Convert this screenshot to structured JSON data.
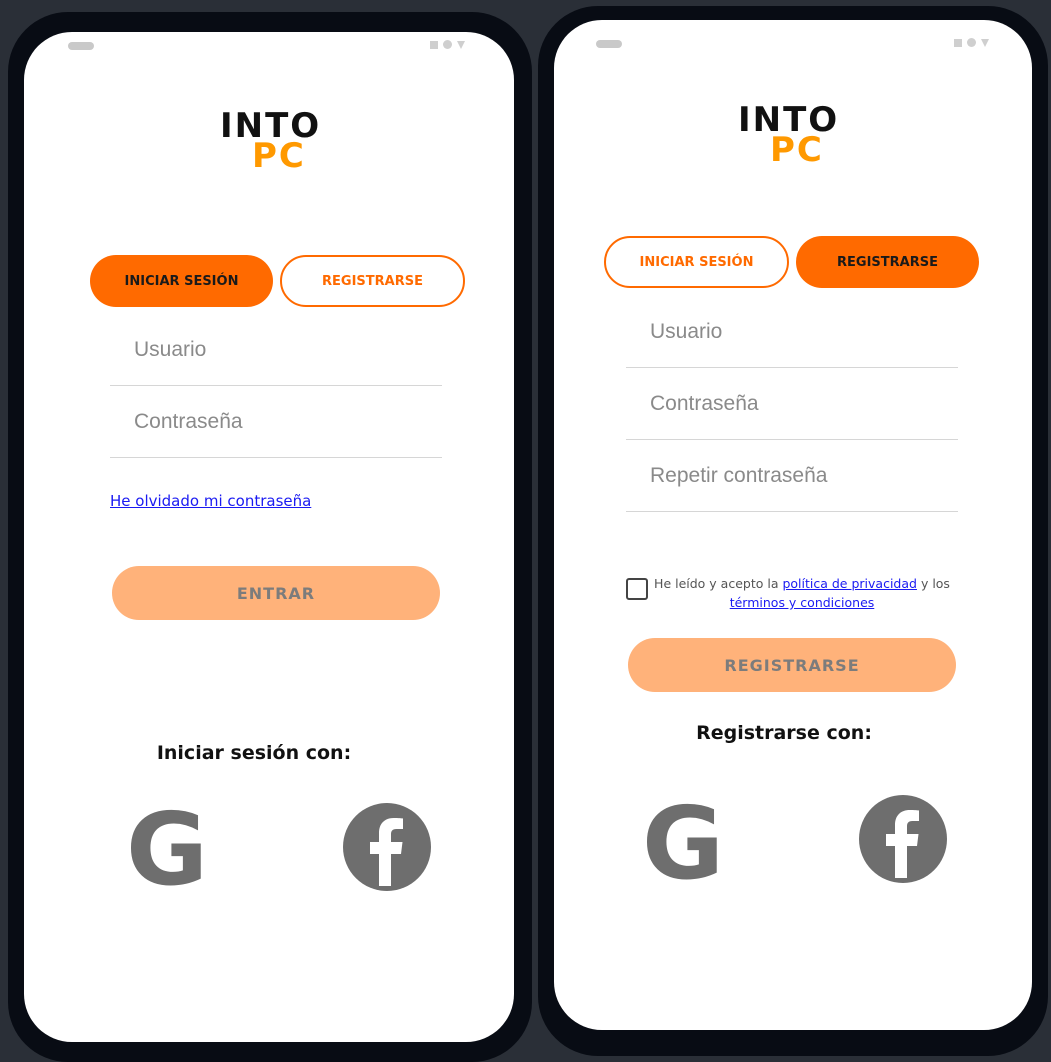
{
  "logo": {
    "into": "INTO",
    "pc": "PC"
  },
  "login_screen": {
    "tabs": {
      "login": "INICIAR SESIÓN",
      "register": "REGISTRARSE"
    },
    "username_placeholder": "Usuario",
    "password_placeholder": "Contraseña",
    "forgot_link": "He olvidado mi contraseña",
    "submit_label": "ENTRAR",
    "social_label": "Iniciar sesión con:"
  },
  "register_screen": {
    "tabs": {
      "login": "INICIAR SESIÓN",
      "register": "REGISTRARSE"
    },
    "username_placeholder": "Usuario",
    "password_placeholder": "Contraseña",
    "repeat_password_placeholder": "Repetir contraseña",
    "terms": {
      "prefix": "He leído y acepto la ",
      "privacy_link": "política de privacidad",
      "middle": " y los ",
      "terms_link": "términos y condiciones"
    },
    "submit_label": "REGISTRARSE",
    "social_label": "Registrarse con:"
  },
  "colors": {
    "accent": "#ff6a00",
    "button_disabled": "#ffb27a",
    "logo_pc": "#ff9900",
    "link": "#1a1af2",
    "social_icon": "#6e6e6e"
  },
  "icons": [
    "google-icon",
    "facebook-icon"
  ]
}
